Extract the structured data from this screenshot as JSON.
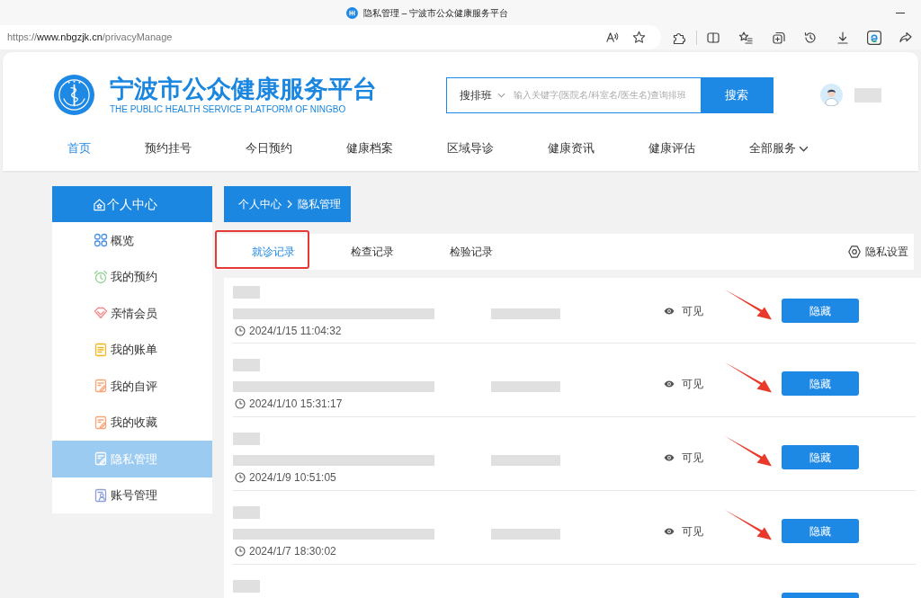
{
  "window": {
    "title": "隐私管理 – 宁波市公众健康服务平台"
  },
  "address_bar": {
    "scheme": "https://",
    "host": "www.nbgzjk.cn",
    "path": "/privacyManage"
  },
  "site": {
    "title": "宁波市公众健康服务平台",
    "subtitle": "THE PUBLIC HEALTH SERVICE PLATFORM OF NINGBO"
  },
  "search": {
    "scope": "搜排班",
    "placeholder": "输入关键字(医院名/科室名/医生名)查询排班",
    "button": "搜索"
  },
  "nav": [
    {
      "label": "首页",
      "selected": true,
      "dropdown": false
    },
    {
      "label": "预约挂号",
      "selected": false,
      "dropdown": false
    },
    {
      "label": "今日预约",
      "selected": false,
      "dropdown": false
    },
    {
      "label": "健康档案",
      "selected": false,
      "dropdown": false
    },
    {
      "label": "区域导诊",
      "selected": false,
      "dropdown": false
    },
    {
      "label": "健康资讯",
      "selected": false,
      "dropdown": false
    },
    {
      "label": "健康评估",
      "selected": false,
      "dropdown": false
    },
    {
      "label": "全部服务",
      "selected": false,
      "dropdown": true
    }
  ],
  "sidebar": {
    "title": "个人中心",
    "items": [
      {
        "label": "概览",
        "selected": false
      },
      {
        "label": "我的预约",
        "selected": false
      },
      {
        "label": "亲情会员",
        "selected": false
      },
      {
        "label": "我的账单",
        "selected": false
      },
      {
        "label": "我的自评",
        "selected": false
      },
      {
        "label": "我的收藏",
        "selected": false
      },
      {
        "label": "隐私管理",
        "selected": true
      },
      {
        "label": "账号管理",
        "selected": false
      }
    ]
  },
  "breadcrumb": [
    "个人中心",
    "隐私管理"
  ],
  "tabs": [
    {
      "label": "就诊记录",
      "selected": true
    },
    {
      "label": "检查记录",
      "selected": false
    },
    {
      "label": "检验记录",
      "selected": false
    }
  ],
  "settings_link": "隐私设置",
  "records": [
    {
      "time": "2024/1/15 11:04:32",
      "status": "可见",
      "action": "隐藏"
    },
    {
      "time": "2024/1/10 15:31:17",
      "status": "可见",
      "action": "隐藏"
    },
    {
      "time": "2024/1/9 10:51:05",
      "status": "可见",
      "action": "隐藏"
    },
    {
      "time": "2024/1/7 18:30:02",
      "status": "可见",
      "action": "隐藏"
    }
  ]
}
